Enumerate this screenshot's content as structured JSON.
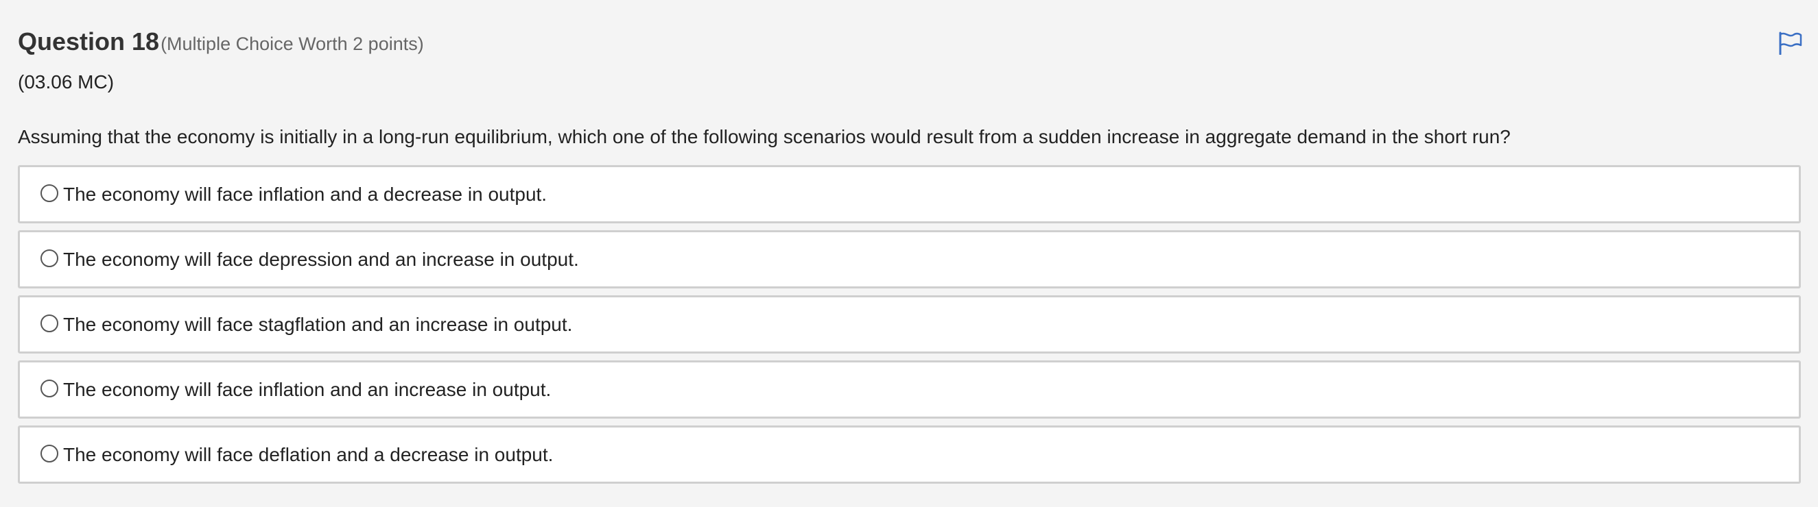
{
  "question": {
    "title": "Question 18",
    "worth": "(Multiple Choice Worth 2 points)",
    "code": "(03.06 MC)",
    "prompt": "Assuming that the economy is initially in a long-run equilibrium, which one of the following scenarios would result from a sudden increase in aggregate demand in the short run?"
  },
  "flag": {
    "icon": "flag-icon",
    "color": "#3a6fc4"
  },
  "options": [
    {
      "label": "The economy will face inflation and a decrease in output.",
      "selected": false
    },
    {
      "label": "The economy will face depression and an increase in output.",
      "selected": false
    },
    {
      "label": "The economy will face stagflation and an increase in output.",
      "selected": false
    },
    {
      "label": "The economy will face inflation and an increase in output.",
      "selected": false
    },
    {
      "label": "The economy will face deflation and a decrease in output.",
      "selected": false
    }
  ]
}
